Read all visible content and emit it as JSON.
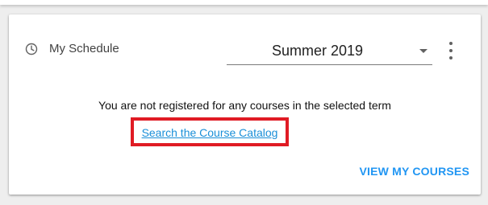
{
  "widget": {
    "title": "My Schedule",
    "icon": "clock-icon",
    "term_selected": "Summer 2019",
    "menu_icon": "more-vert-icon"
  },
  "content": {
    "message": "You are not registered for any courses in the selected term",
    "catalog_link": "Search the Course Catalog",
    "highlight_color": "#e01b24"
  },
  "footer": {
    "action_label": "VIEW MY COURSES",
    "action_color": "#2196f3"
  }
}
